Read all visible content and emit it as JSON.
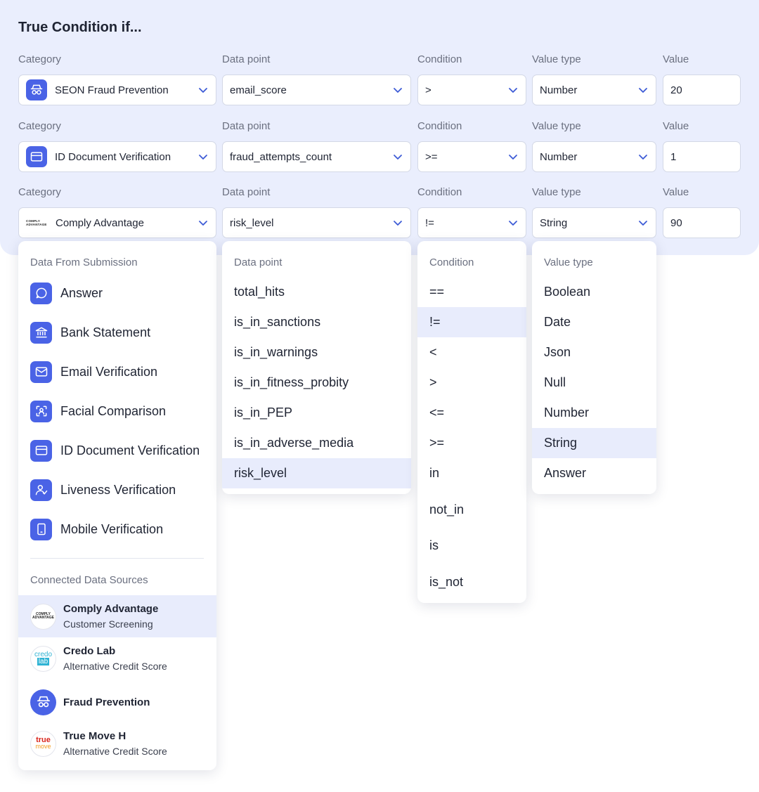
{
  "panel": {
    "title": "True Condition if..."
  },
  "labels": {
    "category": "Category",
    "data_point": "Data point",
    "condition": "Condition",
    "value_type": "Value type",
    "value": "Value"
  },
  "rows": [
    {
      "category": "SEON Fraud Prevention",
      "category_icon": "detective-icon",
      "data_point": "email_score",
      "condition": ">",
      "value_type": "Number",
      "value": "20"
    },
    {
      "category": "ID Document Verification",
      "category_icon": "id-card-icon",
      "data_point": "fraud_attempts_count",
      "condition": ">=",
      "value_type": "Number",
      "value": "1"
    },
    {
      "category": "Comply Advantage",
      "category_icon": "comply-advantage-logo",
      "data_point": "risk_level",
      "condition": "!=",
      "value_type": "String",
      "value": "90"
    }
  ],
  "category_dropdown": {
    "submission_header": "Data From Submission",
    "submission_items": [
      {
        "label": "Answer",
        "icon": "chat-bubble-icon"
      },
      {
        "label": "Bank Statement",
        "icon": "bank-icon"
      },
      {
        "label": "Email Verification",
        "icon": "envelope-icon"
      },
      {
        "label": "Facial Comparison",
        "icon": "face-scan-icon"
      },
      {
        "label": "ID Document Verification",
        "icon": "id-card-icon"
      },
      {
        "label": "Liveness Verification",
        "icon": "user-check-icon"
      },
      {
        "label": "Mobile Verification",
        "icon": "phone-icon"
      }
    ],
    "connected_header": "Connected Data Sources",
    "connected_items": [
      {
        "name": "Comply Advantage",
        "sub": "Customer Screening",
        "logo_text": "COMPLY ADVANTAGE",
        "selected": true
      },
      {
        "name": "Credo Lab",
        "sub": "Alternative Credit Score",
        "logo_text": "credo lab",
        "selected": false
      },
      {
        "name": "Fraud Prevention",
        "sub": "",
        "logo_text": "",
        "selected": false
      },
      {
        "name": "True Move H",
        "sub": "Alternative Credit Score",
        "logo_text": "true move",
        "selected": false
      }
    ]
  },
  "datapoint_dropdown": {
    "header": "Data point",
    "options": [
      "total_hits",
      "is_in_sanctions",
      "is_in_warnings",
      "is_in_fitness_probity",
      "is_in_PEP",
      "is_in_adverse_media",
      "risk_level"
    ],
    "selected": "risk_level"
  },
  "condition_dropdown": {
    "header": "Condition",
    "options": [
      "==",
      "!=",
      "<",
      ">",
      "<=",
      ">=",
      "in",
      "not_in",
      "is",
      "is_not"
    ],
    "selected": "!="
  },
  "valuetype_dropdown": {
    "header": "Value type",
    "options": [
      "Boolean",
      "Date",
      "Json",
      "Null",
      "Number",
      "String",
      "Answer"
    ],
    "selected": "String"
  },
  "colors": {
    "accent": "#4a63e6",
    "panel_bg": "#eaeefd",
    "selected_bg": "#e8ecfc"
  }
}
